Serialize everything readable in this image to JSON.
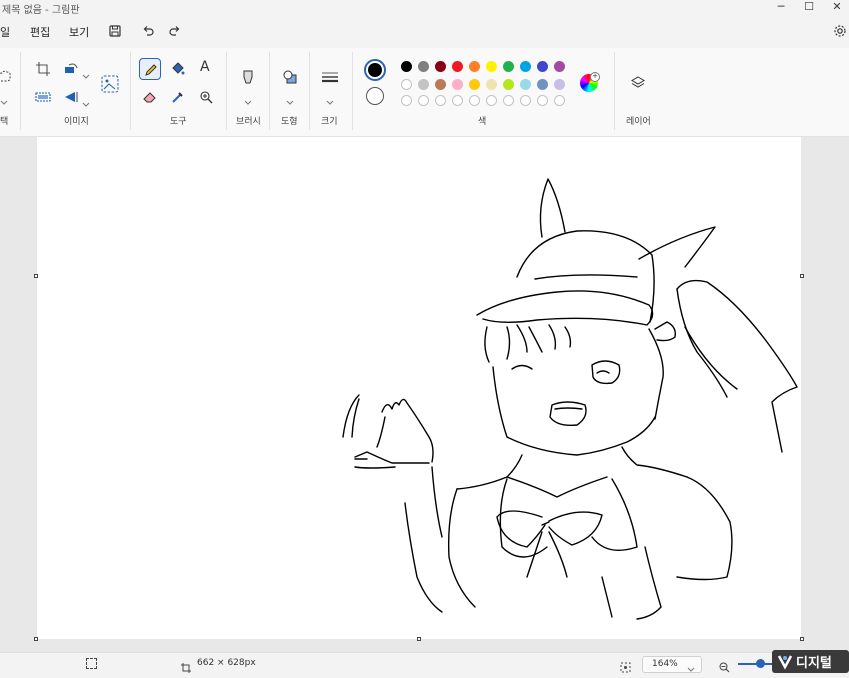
{
  "window": {
    "title": "제목 없음 - 그림판",
    "controls": [
      "─",
      "☐",
      "✕"
    ]
  },
  "menu": {
    "file": "일",
    "edit": "편집",
    "view": "보기"
  },
  "ribbon": {
    "groups": {
      "selection": "택",
      "image": "이미지",
      "tools": "도구",
      "brushes": "브러시",
      "shapes": "도형",
      "size": "크기",
      "colors": "색",
      "layers": "레이어"
    },
    "tools": {
      "text_glyph": "A",
      "selected": "pencil"
    },
    "colors": {
      "primary": "#000000",
      "secondary": "#ffffff",
      "row1": [
        "#000000",
        "#7f7f7f",
        "#880015",
        "#ed1c24",
        "#ff7f27",
        "#fff200",
        "#22b14c",
        "#00a2e8",
        "#3f48cc",
        "#a349a4"
      ],
      "row2": [
        "#ffffff",
        "#c3c3c3",
        "#b97a57",
        "#ffaec9",
        "#ffc90e",
        "#efe4b0",
        "#b5e61d",
        "#99d9ea",
        "#7092be",
        "#c8bfe7"
      ],
      "row3_count": 10
    }
  },
  "status": {
    "canvas_size": "662 × 628px",
    "zoom": "164%"
  },
  "watermark": {
    "text": "디지털"
  }
}
